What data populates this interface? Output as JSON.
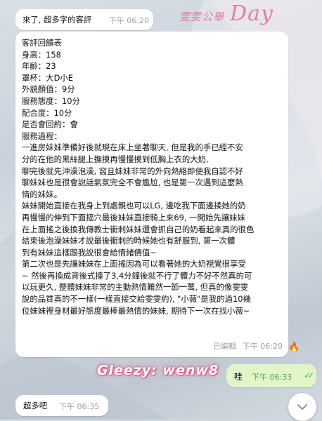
{
  "watermark": {
    "text_small": "雯雯公舉",
    "text_big": "Day"
  },
  "messages": [
    {
      "text": "來了, 超多字的客評",
      "time": "下午 06:20"
    },
    {
      "lines": [
        "客評回饋表",
        "身高：158",
        "年齡：23",
        "罩杯：大D小E",
        "外貌顏值：9分",
        "服務態度：10分",
        "配合度：10分",
        "是否會回約：會",
        "服務過程：",
        "一進房妹妹準備好後就現在床上坐著聊天, 但是我的手已經不安",
        "分的在他的黑絲腿上撫摸再慢慢摸到低胸上衣的大奶,",
        "聊完後就先沖澡泡澡, 窩且妹妹非常的外向熱絡即使我自認不好",
        "聊妹妹也是很會說話氣氛完全不會尷尬, 也是第一次遇到這麼熱",
        "情的妹妹。",
        "妹妹開始直接在我身上到處親也可以LG, 邊吃我下面邊揉她的奶",
        "再慢慢的伸到下面摳穴最後妹妹直接騎上來69, 一開始先讓妹妹",
        "在上面搖之後換我傳教士衝刺妹妹還會抓自己的奶看起來真的很色",
        "結束後泡澡妹妹才說最後衝刺的時候她也有舒服到, 第一次體",
        "到有妹妹這樣跟我說很會給情緒價值~",
        "第二次也是先讓妹妹在上面搖因為可以看著她的大奶視覺很享受",
        "~ 然後再換成背後式撞了3,4分鐘後就不行了體力不好不然真的可",
        "以玩更久, 整體妹妹非常的主動熱情難然一節一萬, 但真的像雯雯",
        "說的品質真的不一樣(一樣直接交給雯雯約), \"小薇\"是我的過10幾",
        "位妹妹裡身材最好態度最棒最熱情的妹妹, 期待下一次在找小薇~"
      ],
      "edited": "已編輯",
      "time": "下午 06:20",
      "reaction": "🔥"
    },
    {
      "text": "哇",
      "time": "下午 06:33",
      "status": "read-double-check"
    },
    {
      "text": "超多吧",
      "time": "下午 06:35"
    }
  ],
  "signature": "Gleezy:  wenw8",
  "colors": {
    "accent_pink": "#e8507f",
    "outgoing_bubble": "#e0f6c8",
    "check_green": "#53b04f"
  },
  "icons": {
    "reaction": "fire-emoji",
    "read_status": "double-check-icon",
    "scroll": "chevron-down-icon"
  }
}
